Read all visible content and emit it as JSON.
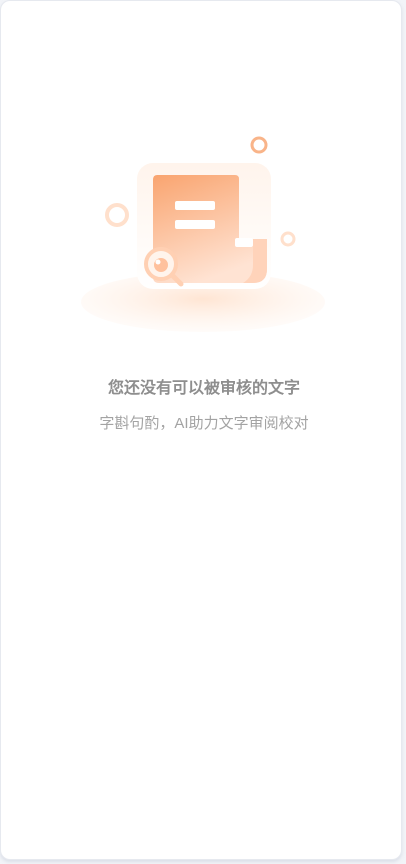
{
  "empty_state": {
    "illustration_icon": "document-review-magnifier-icon",
    "title": "您还没有可以被审核的文字",
    "subtitle": "字斟句酌，AI助力文字审阅校对"
  },
  "colors": {
    "accent_orange": "#f9a97b",
    "accent_light": "#ffe1cf",
    "title_text": "#8e8e8e",
    "subtitle_text": "#a3a3a3",
    "background": "#ffffff"
  }
}
